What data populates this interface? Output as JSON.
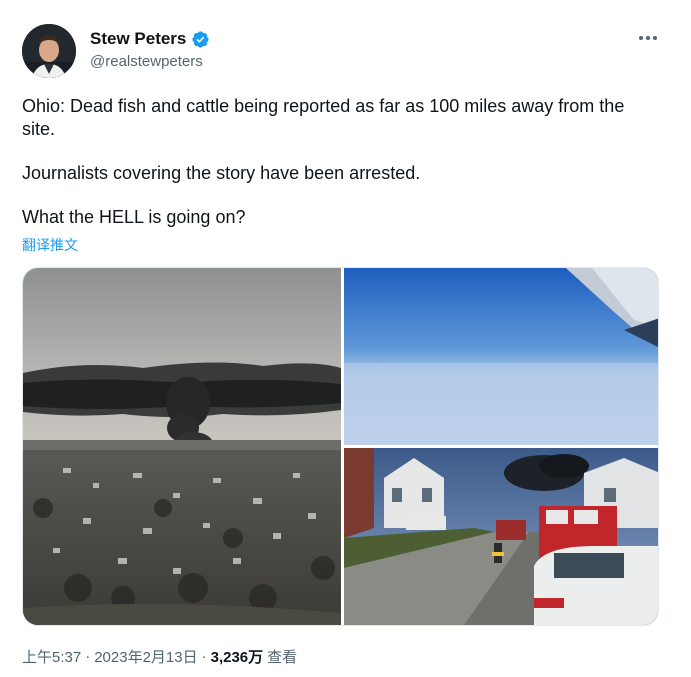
{
  "author": {
    "display_name": "Stew Peters",
    "handle": "@realstewpeters",
    "verified": true,
    "verified_color": "#1d9bf0"
  },
  "tweet": {
    "paragraphs": [
      "Ohio: Dead fish and cattle being reported as far as 100 miles away from the site.",
      "Journalists covering the story have been arrested.",
      "What the HELL is going on?"
    ],
    "translate_label": "翻译推文"
  },
  "media": {
    "count": 3
  },
  "meta": {
    "time": "上午5:37",
    "separator1": "·",
    "date": "2023年2月13日",
    "separator2": "·",
    "views": "3,236万",
    "views_label": "查看"
  },
  "icons": {
    "more": "more-horizontal-icon",
    "verified": "verified-badge-icon"
  },
  "colors": {
    "text": "#0f1419",
    "secondary": "#536471",
    "link": "#1d9bf0"
  }
}
